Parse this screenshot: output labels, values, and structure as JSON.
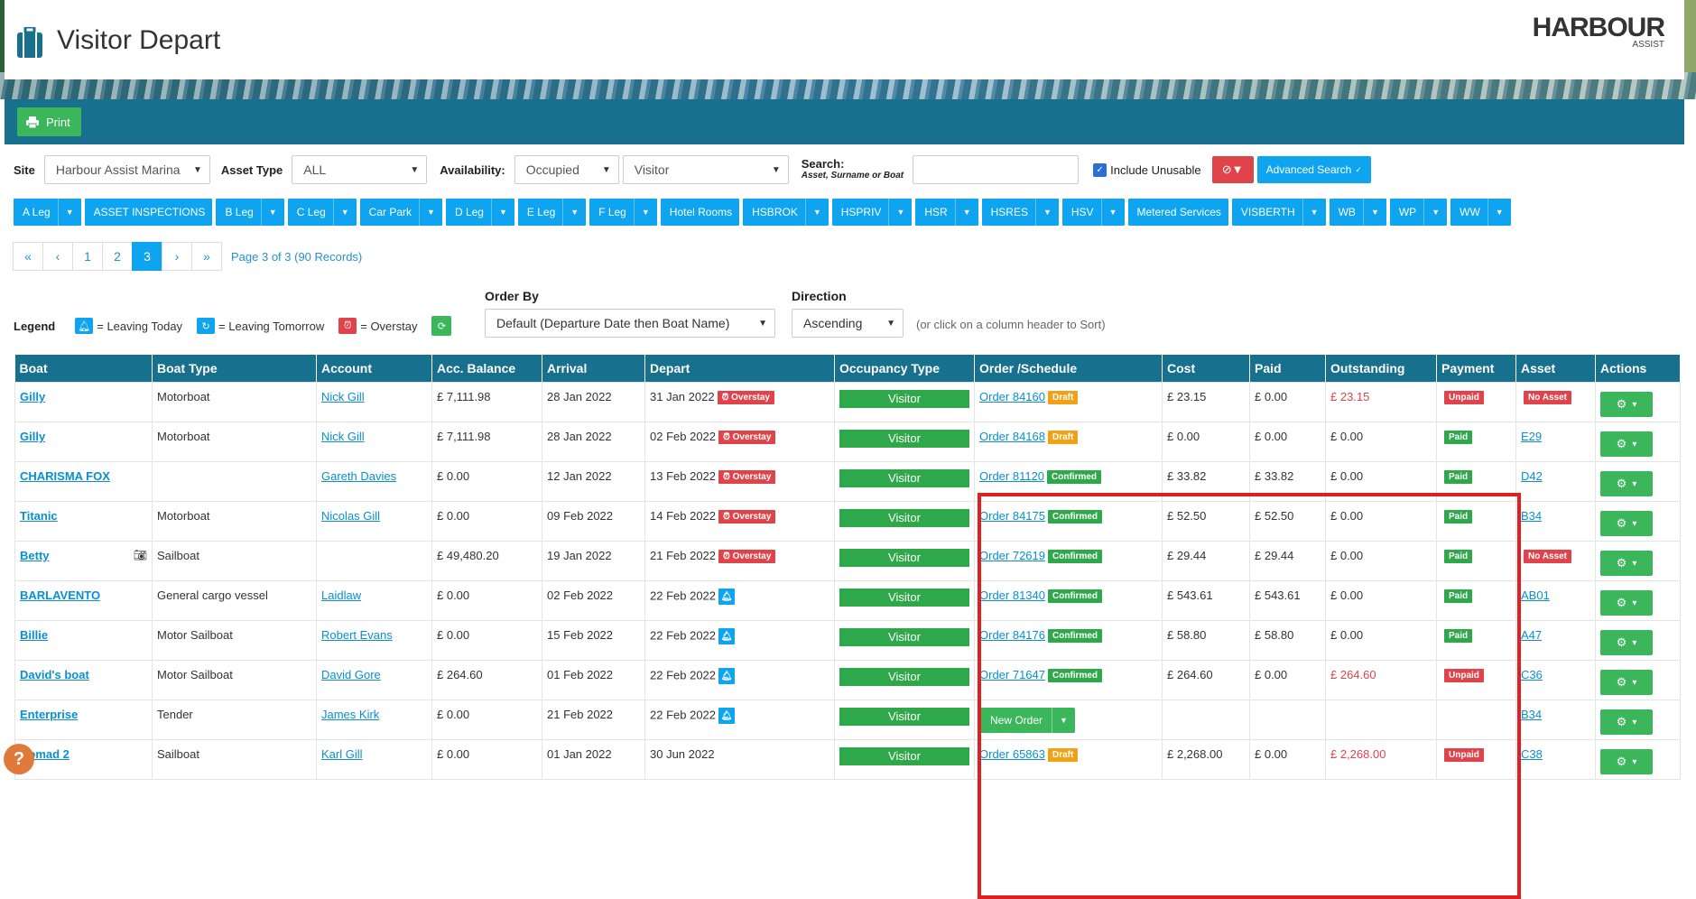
{
  "page": {
    "title": "Visitor Depart"
  },
  "logo": {
    "main": "HARBOUR",
    "sub": "ASSIST"
  },
  "toolbar": {
    "print_label": "Print"
  },
  "filters": {
    "site_label": "Site",
    "site_value": "Harbour Assist Marina",
    "asset_type_label": "Asset Type",
    "asset_type_value": "ALL",
    "availability_label": "Availability:",
    "availability_value": "Occupied",
    "occupant_value": "Visitor",
    "search_label": "Search:",
    "search_hint": "Asset, Surname or Boat",
    "search_value": "",
    "include_unusable_label": "Include Unusable",
    "advanced_search_label": "Advanced Search"
  },
  "tabs": [
    {
      "label": "A Leg",
      "dropdown": true
    },
    {
      "label": "ASSET INSPECTIONS",
      "dropdown": false
    },
    {
      "label": "B Leg",
      "dropdown": true
    },
    {
      "label": "C Leg",
      "dropdown": true
    },
    {
      "label": "Car Park",
      "dropdown": true
    },
    {
      "label": "D Leg",
      "dropdown": true
    },
    {
      "label": "E Leg",
      "dropdown": true
    },
    {
      "label": "F Leg",
      "dropdown": true
    },
    {
      "label": "Hotel Rooms",
      "dropdown": false
    },
    {
      "label": "HSBROK",
      "dropdown": true
    },
    {
      "label": "HSPRIV",
      "dropdown": true
    },
    {
      "label": "HSR",
      "dropdown": true
    },
    {
      "label": "HSRES",
      "dropdown": true
    },
    {
      "label": "HSV",
      "dropdown": true
    },
    {
      "label": "Metered Services",
      "dropdown": false
    },
    {
      "label": "VISBERTH",
      "dropdown": true
    },
    {
      "label": "WB",
      "dropdown": true
    },
    {
      "label": "WP",
      "dropdown": true
    },
    {
      "label": "WW",
      "dropdown": true
    }
  ],
  "pagination": {
    "first": "«",
    "prev": "‹",
    "pages": [
      "1",
      "2",
      "3"
    ],
    "current": "3",
    "next": "›",
    "last": "»",
    "info": "Page 3 of 3 (90 Records)"
  },
  "legend": {
    "title": "Legend",
    "leaving_today": "= Leaving Today",
    "leaving_tomorrow": "= Leaving Tomorrow",
    "overstay": "= Overstay"
  },
  "order_by": {
    "label": "Order By",
    "value": "Default (Departure Date then Boat Name)"
  },
  "direction": {
    "label": "Direction",
    "value": "Ascending"
  },
  "sort_hint": "(or click on a column header to Sort)",
  "table": {
    "headers": [
      "Boat",
      "Boat Type",
      "Account",
      "Acc. Balance",
      "Arrival",
      "Depart",
      "Occupancy Type",
      "Order /Schedule",
      "Cost",
      "Paid",
      "Outstanding",
      "Payment",
      "Asset",
      "Actions"
    ],
    "rows": [
      {
        "boat": "Gilly",
        "type": "Motorboat",
        "account": "Nick Gill",
        "balance": "£ 7,111.98",
        "arrival": "28 Jan 2022",
        "depart": "31 Jan 2022",
        "depart_flag": "Overstay",
        "occupancy": "Visitor",
        "order": "Order 84160",
        "order_status": "Draft",
        "cost": "£ 23.15",
        "paid": "£ 0.00",
        "outstanding": "£ 23.15",
        "outstanding_red": true,
        "payment": "Unpaid",
        "asset": "No Asset",
        "asset_badge": true
      },
      {
        "boat": "Gilly",
        "type": "Motorboat",
        "account": "Nick Gill",
        "balance": "£ 7,111.98",
        "arrival": "28 Jan 2022",
        "depart": "02 Feb 2022",
        "depart_flag": "Overstay",
        "occupancy": "Visitor",
        "order": "Order 84168",
        "order_status": "Draft",
        "cost": "£ 0.00",
        "paid": "£ 0.00",
        "outstanding": "£ 0.00",
        "outstanding_red": false,
        "payment": "Paid",
        "asset": "E29",
        "asset_badge": false
      },
      {
        "boat": "CHARISMA FOX",
        "type": "",
        "account": "Gareth Davies",
        "balance": "£ 0.00",
        "arrival": "12 Jan 2022",
        "depart": "13 Feb 2022",
        "depart_flag": "Overstay",
        "occupancy": "Visitor",
        "order": "Order 81120",
        "order_status": "Confirmed",
        "cost": "£ 33.82",
        "paid": "£ 33.82",
        "outstanding": "£ 0.00",
        "outstanding_red": false,
        "payment": "Paid",
        "asset": "D42",
        "asset_badge": false
      },
      {
        "boat": "Titanic",
        "type": "Motorboat",
        "account": "Nicolas Gill",
        "balance": "£ 0.00",
        "arrival": "09 Feb 2022",
        "depart": "14 Feb 2022",
        "depart_flag": "Overstay",
        "occupancy": "Visitor",
        "order": "Order 84175",
        "order_status": "Confirmed",
        "cost": "£ 52.50",
        "paid": "£ 52.50",
        "outstanding": "£ 0.00",
        "outstanding_red": false,
        "payment": "Paid",
        "asset": "B34",
        "asset_badge": false
      },
      {
        "boat": "Betty",
        "camera": true,
        "type": "Sailboat",
        "account": "",
        "balance": "£ 49,480.20",
        "arrival": "19 Jan 2022",
        "depart": "21 Feb 2022",
        "depart_flag": "Overstay",
        "occupancy": "Visitor",
        "order": "Order 72619",
        "order_status": "Confirmed",
        "cost": "£ 29.44",
        "paid": "£ 29.44",
        "outstanding": "£ 0.00",
        "outstanding_red": false,
        "payment": "Paid",
        "asset": "No Asset",
        "asset_badge": true
      },
      {
        "boat": "BARLAVENTO",
        "type": "General cargo vessel",
        "account": "Laidlaw",
        "balance": "£ 0.00",
        "arrival": "02 Feb 2022",
        "depart": "22 Feb 2022",
        "depart_flag": "bell",
        "occupancy": "Visitor",
        "order": "Order 81340",
        "order_status": "Confirmed",
        "cost": "£ 543.61",
        "paid": "£ 543.61",
        "outstanding": "£ 0.00",
        "outstanding_red": false,
        "payment": "Paid",
        "asset": "AB01",
        "asset_badge": false
      },
      {
        "boat": "Billie",
        "type": "Motor Sailboat",
        "account": "Robert Evans",
        "balance": "£ 0.00",
        "arrival": "15 Feb 2022",
        "depart": "22 Feb 2022",
        "depart_flag": "bell",
        "occupancy": "Visitor",
        "order": "Order 84176",
        "order_status": "Confirmed",
        "cost": "£ 58.80",
        "paid": "£ 58.80",
        "outstanding": "£ 0.00",
        "outstanding_red": false,
        "payment": "Paid",
        "asset": "A47",
        "asset_badge": false
      },
      {
        "boat": "David's boat",
        "type": "Motor Sailboat",
        "account": "David Gore",
        "balance": "£ 264.60",
        "arrival": "01 Feb 2022",
        "depart": "22 Feb 2022",
        "depart_flag": "bell",
        "occupancy": "Visitor",
        "order": "Order 71647",
        "order_status": "Confirmed",
        "cost": "£ 264.60",
        "paid": "£ 0.00",
        "outstanding": "£ 264.60",
        "outstanding_red": true,
        "payment": "Unpaid",
        "asset": "C36",
        "asset_badge": false
      },
      {
        "boat": "Enterprise",
        "type": "Tender",
        "account": "James Kirk",
        "balance": "£ 0.00",
        "arrival": "21 Feb 2022",
        "depart": "22 Feb 2022",
        "depart_flag": "bell",
        "occupancy": "Visitor",
        "order": "",
        "new_order": "New Order",
        "order_status": "",
        "cost": "",
        "paid": "",
        "outstanding": "",
        "outstanding_red": false,
        "payment": "",
        "asset": "B34",
        "asset_badge": false
      },
      {
        "boat": "Nomad 2",
        "type": "Sailboat",
        "account": "Karl Gill",
        "balance": "£ 0.00",
        "arrival": "01 Jan 2022",
        "depart": "30 Jun 2022",
        "depart_flag": "",
        "occupancy": "Visitor",
        "order": "Order 65863",
        "order_status": "Draft",
        "cost": "£ 2,268.00",
        "paid": "£ 0.00",
        "outstanding": "£ 2,268.00",
        "outstanding_red": true,
        "payment": "Unpaid",
        "asset": "C38",
        "asset_badge": false
      }
    ]
  },
  "colors": {
    "header_band": "#17708e",
    "accent_blue": "#0ea4ef",
    "green": "#3cb65a",
    "red": "#e0444a",
    "orange": "#f2a114"
  }
}
